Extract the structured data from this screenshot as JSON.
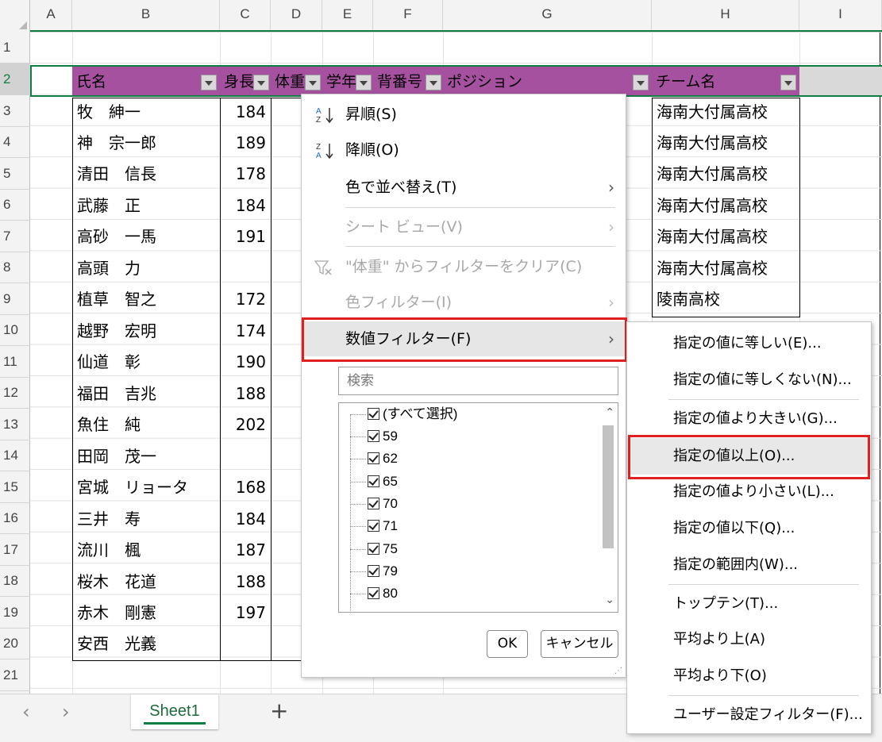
{
  "columns": [
    "A",
    "B",
    "C",
    "D",
    "E",
    "F",
    "G",
    "H",
    "I"
  ],
  "rows": [
    "1",
    "2",
    "3",
    "4",
    "5",
    "6",
    "7",
    "8",
    "9",
    "10",
    "11",
    "12",
    "13",
    "14",
    "15",
    "16",
    "17",
    "18",
    "19",
    "20",
    "21"
  ],
  "headers": {
    "name": "氏名",
    "height": "身長",
    "weight": "体重",
    "grade": "学年",
    "number": "背番号",
    "position": "ポジション",
    "team": "チーム名"
  },
  "names": [
    "牧　紳一",
    "神　宗一郎",
    "清田　信長",
    "武藤　正",
    "高砂　一馬",
    "高頭　力",
    "植草　智之",
    "越野　宏明",
    "仙道　彰",
    "福田　吉兆",
    "魚住　純",
    "田岡　茂一",
    "宮城　リョータ",
    "三井　寿",
    "流川　楓",
    "桜木　花道",
    "赤木　剛憲",
    "安西　光義"
  ],
  "heights": [
    "184",
    "189",
    "178",
    "184",
    "191",
    "",
    "172",
    "174",
    "190",
    "188",
    "202",
    "",
    "168",
    "184",
    "187",
    "188",
    "197",
    ""
  ],
  "teams": [
    "海南大付属高校",
    "海南大付属高校",
    "海南大付属高校",
    "海南大付属高校",
    "海南大付属高校",
    "海南大付属高校",
    "陵南高校"
  ],
  "menu": {
    "sort_asc": "昇順(S)",
    "sort_desc": "降順(O)",
    "sort_color": "色で並べ替え(T)",
    "sheet_view": "シート ビュー(V)",
    "clear_filter": "\"体重\" からフィルターをクリア(C)",
    "color_filter": "色フィルター(I)",
    "number_filter": "数値フィルター(F)",
    "search_placeholder": "検索",
    "select_all": "(すべて選択)",
    "values": [
      "59",
      "62",
      "65",
      "70",
      "71",
      "75",
      "79",
      "80"
    ],
    "ok": "OK",
    "cancel": "キャンセル"
  },
  "submenu": {
    "equals": "指定の値に等しい(E)...",
    "not_equals": "指定の値に等しくない(N)...",
    "greater": "指定の値より大きい(G)...",
    "greater_equal": "指定の値以上(O)...",
    "less": "指定の値より小さい(L)...",
    "less_equal": "指定の値以下(Q)...",
    "between": "指定の範囲内(W)...",
    "top_ten": "トップテン(T)...",
    "above_avg": "平均より上(A)",
    "below_avg": "平均より下(O)",
    "custom": "ユーザー設定フィルター(F)..."
  },
  "sheet_tab": "Sheet1",
  "add_sheet": "+",
  "colors": {
    "header_fill": "#a5519f",
    "highlight": "#e02020",
    "excel_green": "#107c41"
  }
}
